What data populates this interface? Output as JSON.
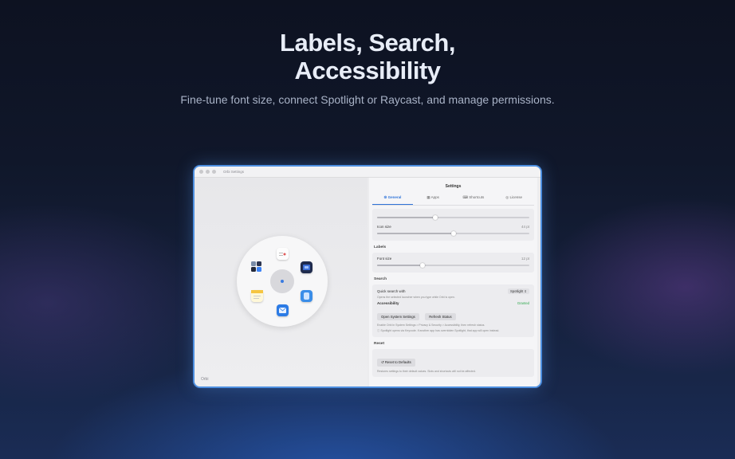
{
  "hero": {
    "title_line1": "Labels, Search,",
    "title_line2": "Accessibility",
    "subtitle": "Fine-tune font size, connect Spotlight or Raycast, and manage permissions."
  },
  "window": {
    "title": "Orbi Settings",
    "version": "Orbi"
  },
  "settings": {
    "title": "Settings",
    "tabs": [
      {
        "label": "General",
        "icon": "gear-icon",
        "active": true
      },
      {
        "label": "Apps",
        "icon": "grid-icon",
        "active": false
      },
      {
        "label": "Shortcuts",
        "icon": "keyboard-icon",
        "active": false
      },
      {
        "label": "License",
        "icon": "badge-icon",
        "active": false
      }
    ],
    "first_slider": {
      "value_fraction": 0.38
    },
    "icon_size": {
      "label": "Icon size",
      "value": "44 pt",
      "value_fraction": 0.5
    },
    "labels_section": "Labels",
    "font_size": {
      "label": "Font size",
      "value": "12 pt",
      "value_fraction": 0.3
    },
    "search_section": "Search",
    "quick_search": {
      "label": "Quick search with",
      "selected": "Spotlight",
      "desc": "Opens the selected launcher when you type while Orbi is open."
    },
    "accessibility": {
      "label": "Accessibility",
      "status": "Granted",
      "open_button": "Open System Settings",
      "refresh_button": "Refresh Status",
      "desc": "Enable Orbi in System Settings > Privacy & Security > Accessibility, then refresh status.",
      "note": "Spotlight opens via Keycode. If another app has overridden Spotlight, that app will open instead."
    },
    "reset_section": "Reset",
    "reset": {
      "button": "Reset to Defaults",
      "desc": "Restores settings to their default values. Slots and shortcuts will not be affected."
    }
  },
  "colors": {
    "accent": "#2f74d9",
    "granted": "#2ea84c",
    "window_border": "#4d8fe0"
  }
}
